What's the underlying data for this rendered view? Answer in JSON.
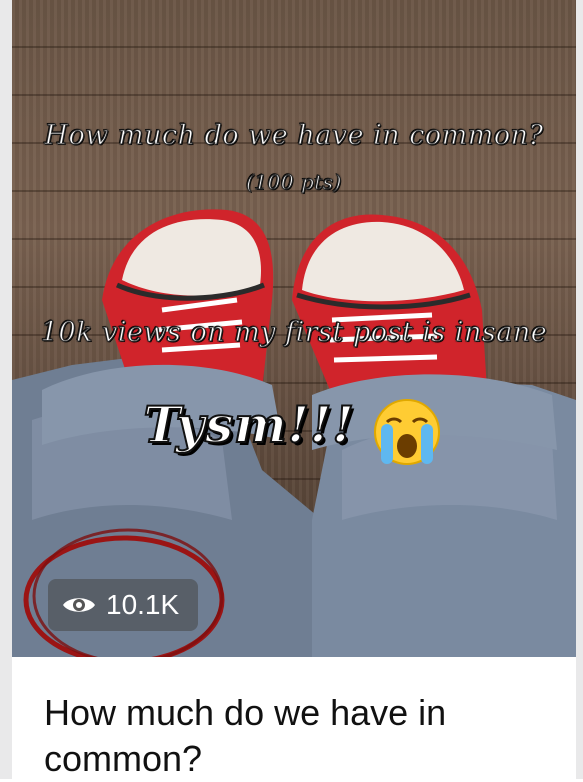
{
  "post": {
    "overlay_line1": "How much do we have in common?",
    "overlay_line2": "(100 pts)",
    "overlay_line3": "10k views on my first post is insane",
    "overlay_line4": "Tysm!!!",
    "views_count": "10.1K",
    "caption": "How much do we have in common?"
  },
  "icons": {
    "eye": "eye-icon",
    "emoji": "loudly-crying-face-emoji"
  },
  "colors": {
    "annotation_circle": "#9b1414",
    "shoe_red": "#d0242b",
    "badge_bg": "#464646"
  }
}
